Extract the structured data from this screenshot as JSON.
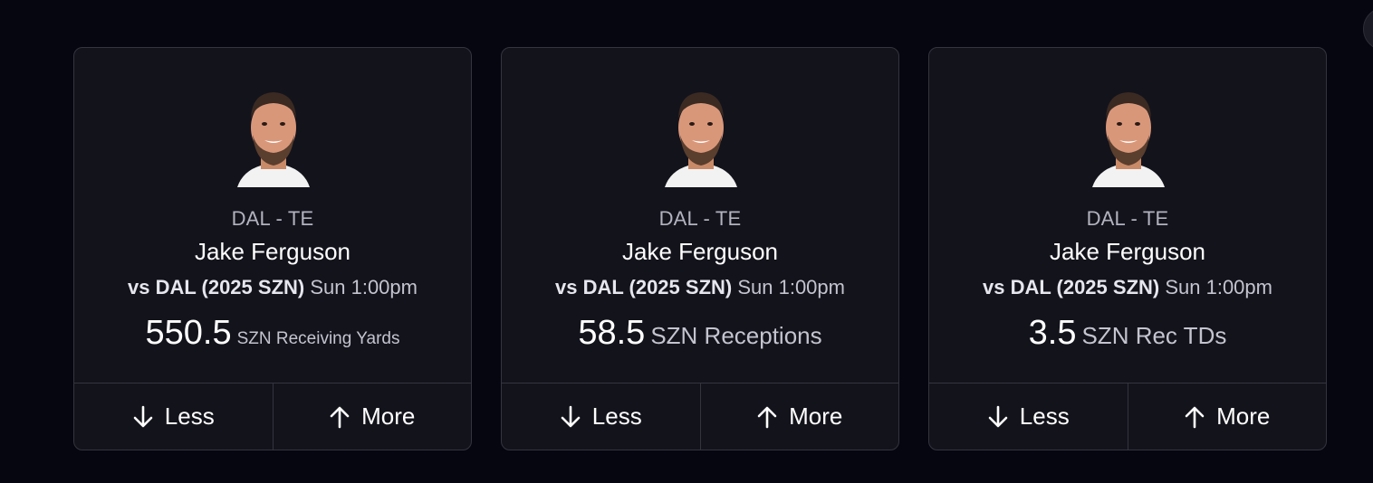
{
  "cards": [
    {
      "team_pos": "DAL - TE",
      "player": "Jake Ferguson",
      "opponent": "vs DAL (2025 SZN)",
      "game_time": "Sun 1:00pm",
      "line": "550.5",
      "stat": "SZN Receiving Yards",
      "less_label": "Less",
      "more_label": "More"
    },
    {
      "team_pos": "DAL - TE",
      "player": "Jake Ferguson",
      "opponent": "vs DAL (2025 SZN)",
      "game_time": "Sun 1:00pm",
      "line": "58.5",
      "stat": "SZN Receptions",
      "less_label": "Less",
      "more_label": "More"
    },
    {
      "team_pos": "DAL - TE",
      "player": "Jake Ferguson",
      "opponent": "vs DAL (2025 SZN)",
      "game_time": "Sun 1:00pm",
      "line": "3.5",
      "stat": "SZN Rec TDs",
      "less_label": "Less",
      "more_label": "More"
    }
  ],
  "icons": {
    "less": "arrow-down-icon",
    "more": "arrow-up-icon"
  },
  "colors": {
    "background": "#05060f",
    "card": "#13131c",
    "border": "#34343f",
    "text": "#ffffff",
    "muted": "#b3b3bf"
  }
}
